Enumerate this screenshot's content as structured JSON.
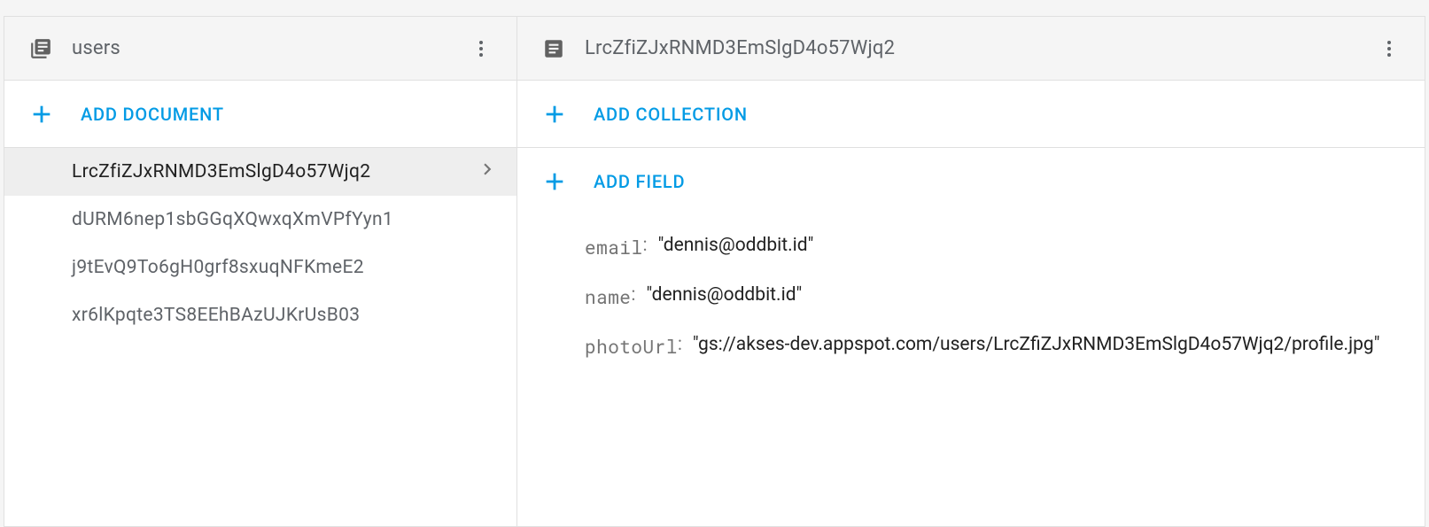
{
  "collection_panel": {
    "title": "users",
    "add_label": "ADD DOCUMENT",
    "documents": [
      {
        "id": "LrcZfiZJxRNMD3EmSlgD4o57Wjq2",
        "selected": true
      },
      {
        "id": "dURM6nep1sbGGqXQwxqXmVPfYyn1",
        "selected": false
      },
      {
        "id": "j9tEvQ9To6gH0grf8sxuqNFKmeE2",
        "selected": false
      },
      {
        "id": "xr6lKpqte3TS8EEhBAzUJKrUsB03",
        "selected": false
      }
    ]
  },
  "document_panel": {
    "title": "LrcZfiZJxRNMD3EmSlgD4o57Wjq2",
    "add_collection_label": "ADD COLLECTION",
    "add_field_label": "ADD FIELD",
    "fields": [
      {
        "key": "email",
        "value": "\"dennis@oddbit.id\""
      },
      {
        "key": "name",
        "value": "\"dennis@oddbit.id\""
      },
      {
        "key": "photoUrl",
        "value": "\"gs://akses-dev.appspot.com/users/LrcZfiZJxRNMD3EmSlgD4o57Wjq2/profile.jpg\""
      }
    ]
  }
}
